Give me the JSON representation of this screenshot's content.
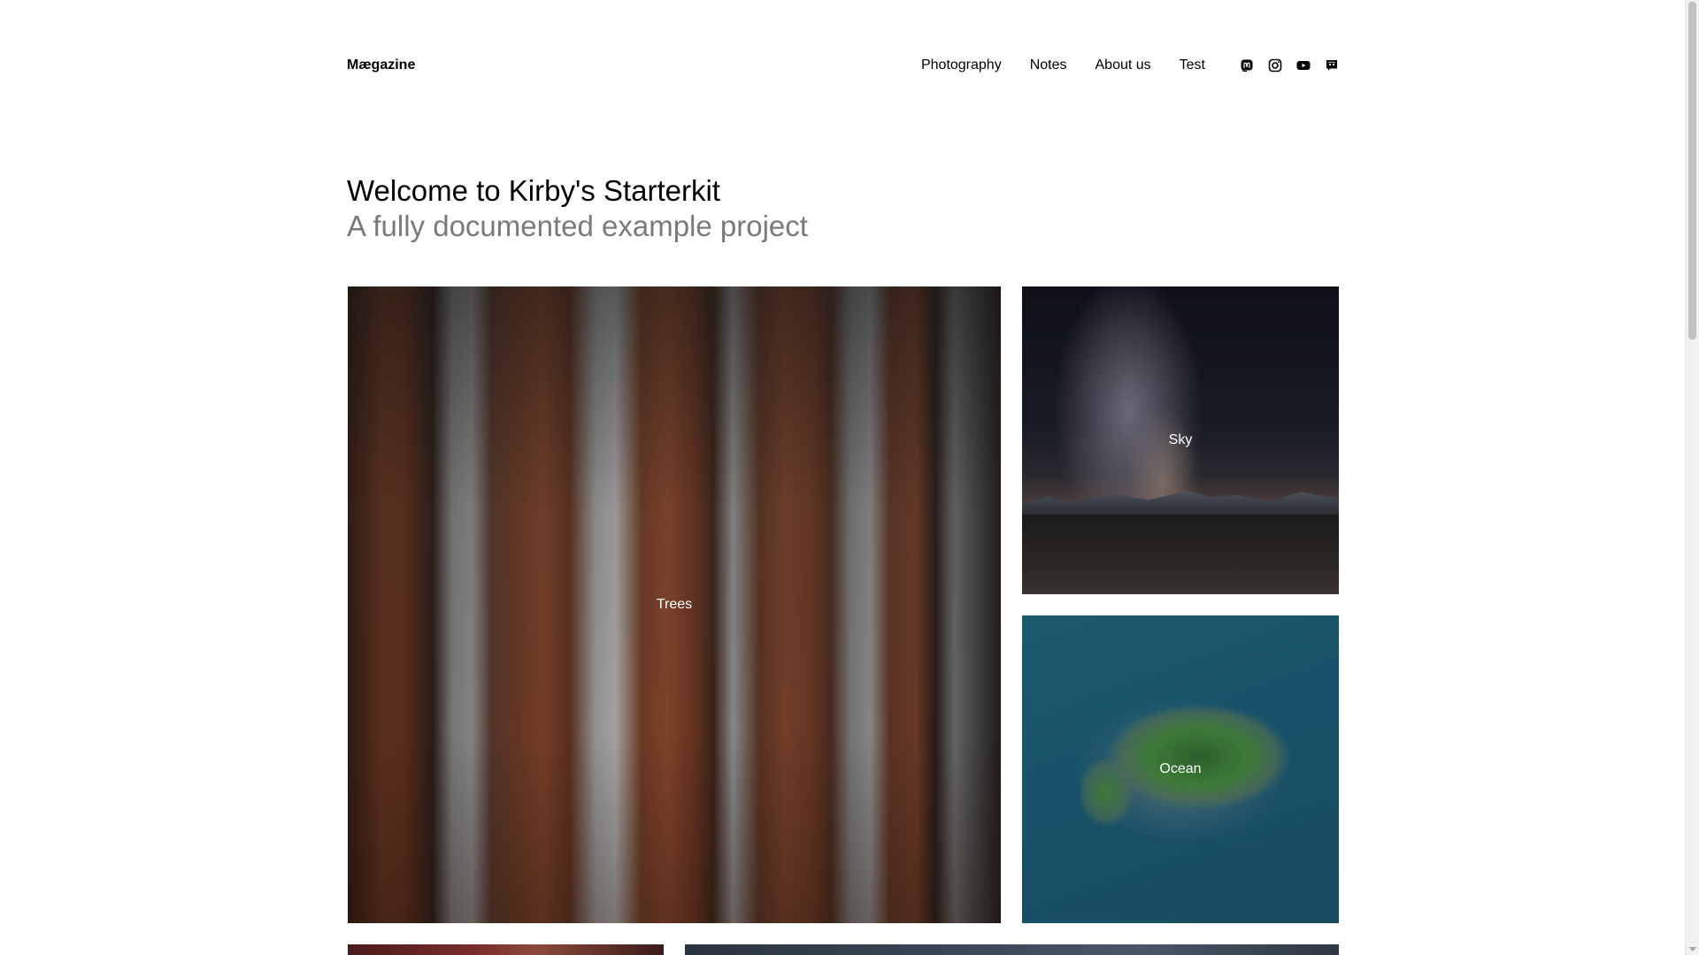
{
  "header": {
    "logo": "Mægazine",
    "nav": [
      {
        "label": "Photography"
      },
      {
        "label": "Notes"
      },
      {
        "label": "About us"
      },
      {
        "label": "Test"
      }
    ],
    "social": [
      {
        "icon": "mastodon-icon"
      },
      {
        "icon": "instagram-icon"
      },
      {
        "icon": "youtube-icon"
      },
      {
        "icon": "discord-icon"
      }
    ]
  },
  "intro": {
    "title": "Welcome to Kirby's Starterkit",
    "subtitle": "A fully documented example project"
  },
  "gallery": {
    "items": [
      {
        "caption": "Trees"
      },
      {
        "caption": "Sky"
      },
      {
        "caption": "Ocean"
      }
    ]
  },
  "colors": {
    "text": "#000000",
    "subtitle": "#7a7a7a",
    "caption": "#ffffff",
    "background": "#ffffff"
  }
}
